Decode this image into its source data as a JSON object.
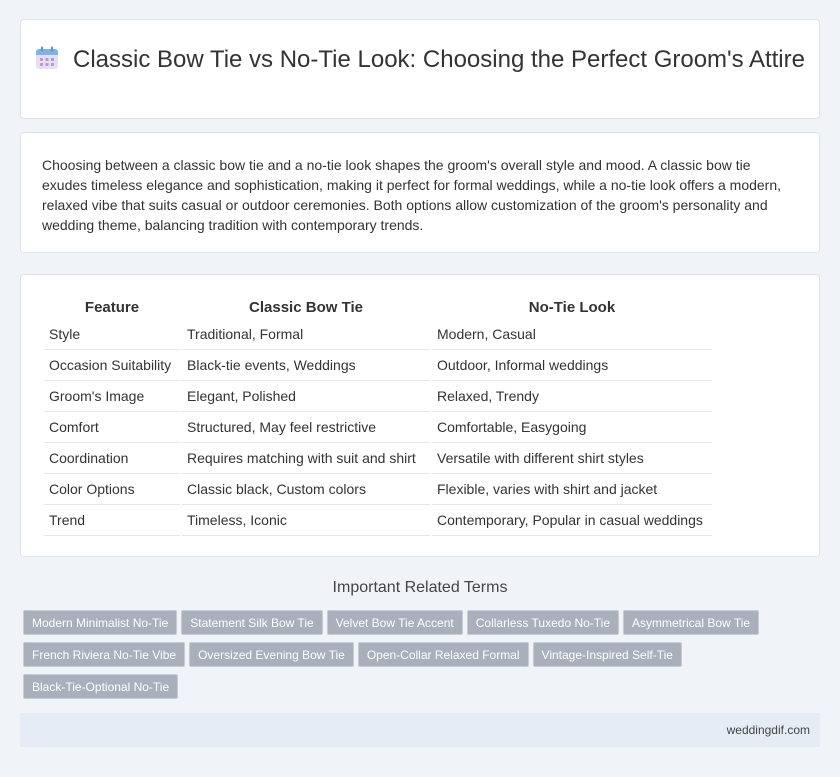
{
  "header": {
    "title": "Classic Bow Tie vs No-Tie Look: Choosing the Perfect Groom's Attire",
    "icon": "calendar-icon"
  },
  "intro": {
    "text": "Choosing between a classic bow tie and a no-tie look shapes the groom's overall style and mood. A classic bow tie exudes timeless elegance and sophistication, making it perfect for formal weddings, while a no-tie look offers a modern, relaxed vibe that suits casual or outdoor ceremonies. Both options allow customization of the groom's personality and wedding theme, balancing tradition with contemporary trends."
  },
  "table": {
    "headers": [
      "Feature",
      "Classic Bow Tie",
      "No-Tie Look"
    ],
    "rows": [
      [
        "Style",
        "Traditional, Formal",
        "Modern, Casual"
      ],
      [
        "Occasion Suitability",
        "Black-tie events, Weddings",
        "Outdoor, Informal weddings"
      ],
      [
        "Groom's Image",
        "Elegant, Polished",
        "Relaxed, Trendy"
      ],
      [
        "Comfort",
        "Structured, May feel restrictive",
        "Comfortable, Easygoing"
      ],
      [
        "Coordination",
        "Requires matching with suit and shirt",
        "Versatile with different shirt styles"
      ],
      [
        "Color Options",
        "Classic black, Custom colors",
        "Flexible, varies with shirt and jacket"
      ],
      [
        "Trend",
        "Timeless, Iconic",
        "Contemporary, Popular in casual weddings"
      ]
    ]
  },
  "related": {
    "title": "Important Related Terms",
    "tags": [
      "Modern Minimalist No-Tie",
      "Statement Silk Bow Tie",
      "Velvet Bow Tie Accent",
      "Collarless Tuxedo No-Tie",
      "Asymmetrical Bow Tie",
      "French Riviera No-Tie Vibe",
      "Oversized Evening Bow Tie",
      "Open-Collar Relaxed Formal",
      "Vintage-Inspired Self-Tie",
      "Black-Tie-Optional No-Tie"
    ]
  },
  "footer": {
    "site": "weddingdif.com"
  },
  "colors": {
    "background": "#f0f3f8",
    "tag": "#a9b0bb",
    "footer": "#e6ecf6"
  }
}
